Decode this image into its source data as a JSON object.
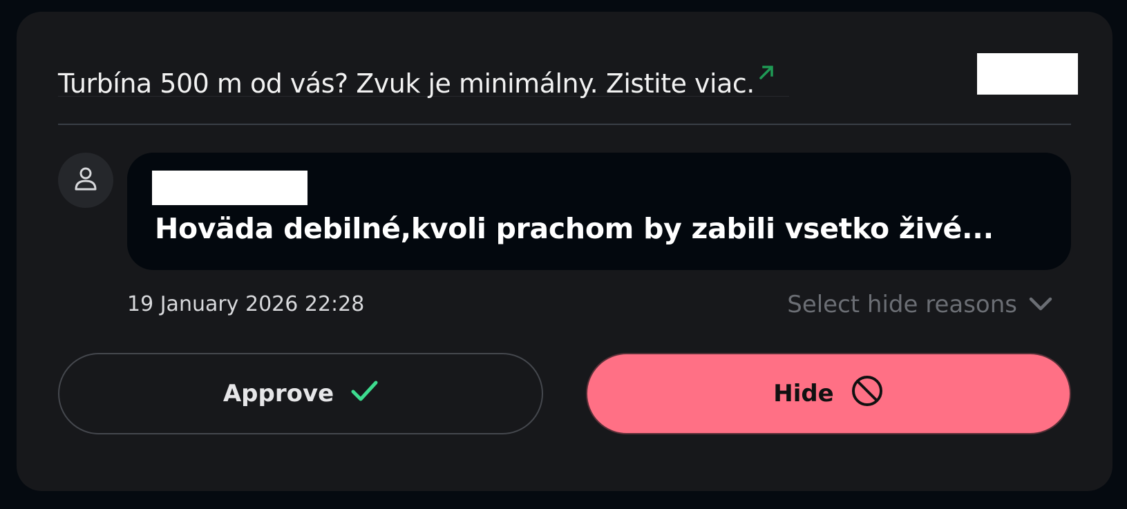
{
  "ad": {
    "title": "Turbína 500 m od vás? Zvuk je minimálny. Zistite viac.",
    "external_link_icon": "arrow-up-right-icon",
    "accent_color": "#1f9a55"
  },
  "comment": {
    "text": "Hoväda debilné,kvoli prachom by zabili vsetko živé...",
    "timestamp": "19 January 2026 22:28",
    "avatar_icon": "user-icon"
  },
  "moderation": {
    "hide_reasons_placeholder": "Select hide reasons",
    "approve_label": "Approve",
    "hide_label": "Hide",
    "approve_icon": "checkmark-icon",
    "hide_icon": "prohibited-icon",
    "approve_icon_color": "#3ddc8f",
    "hide_button_color": "#ff7085"
  }
}
